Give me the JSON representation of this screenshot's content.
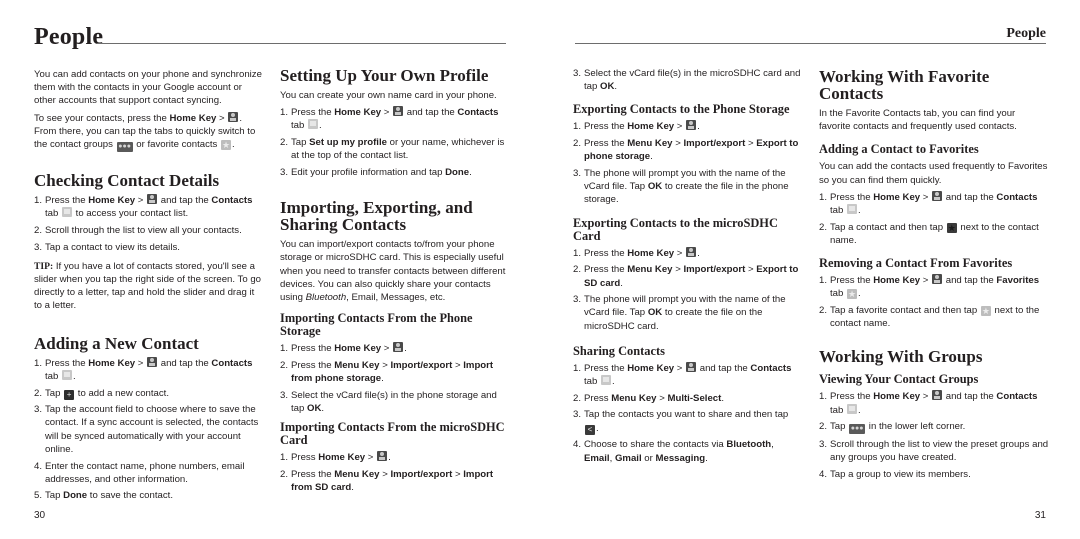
{
  "header": {
    "chapter_title": "People",
    "running_head": "People"
  },
  "page_numbers": {
    "left": "30",
    "right": "31"
  },
  "intro": {
    "p1": "You can add contacts on your phone and synchronize them with the contacts in your Google account or other accounts that support contact syncing.",
    "p2_a": "To see your contacts, press the ",
    "p2_b": "Home Key",
    "p2_c": " > ",
    "p2_d": ". From there, you can tap the tabs to quickly switch to the contact groups ",
    "p2_e": " or favorite contacts ",
    "p2_f": "."
  },
  "checking": {
    "title": "Checking Contact Details",
    "s1": {
      "n": "1.",
      "a": "Press the ",
      "b": "Home Key",
      "c": " > ",
      "d": " and tap the ",
      "e": "Contacts",
      "f": " tab ",
      "g": " to access your contact list."
    },
    "s2": {
      "n": "2.",
      "a": "Scroll through the list to view all your contacts."
    },
    "s3": {
      "n": "3.",
      "a": "Tap a contact to view its details."
    },
    "tip_label": "TIP:",
    "tip_text": " If you have a lot of contacts stored, you'll see a slider when you tap the right side of the screen. To go directly to a letter, tap and hold the slider and drag it to a letter."
  },
  "adding": {
    "title": "Adding a New Contact",
    "s1": {
      "n": "1.",
      "a": "Press the ",
      "b": "Home Key",
      "c": " > ",
      "d": " and tap the ",
      "e": "Contacts",
      "f": " tab ",
      "g": "."
    },
    "s2": {
      "n": "2.",
      "a": "Tap ",
      "b": " to add a new contact."
    },
    "s3": {
      "n": "3.",
      "a": "Tap the account field to choose where to save the contact. If a sync account is selected, the contacts will be synced automatically with your account online."
    },
    "s4": {
      "n": "4.",
      "a": "Enter the contact name, phone numbers, email addresses, and other information."
    },
    "s5": {
      "n": "5.",
      "a": "Tap ",
      "b": "Done",
      "c": " to save the contact."
    }
  },
  "profile": {
    "title": "Setting Up Your Own Profile",
    "intro": "You can create your own name card in your phone.",
    "s1": {
      "n": "1.",
      "a": "Press the ",
      "b": "Home Key",
      "c": " > ",
      "d": " and tap the ",
      "e": "Contacts",
      "f": " tab ",
      "g": "."
    },
    "s2": {
      "n": "2.",
      "a": "Tap ",
      "b": "Set up my profile",
      "c": " or your name, whichever is at the top of the contact list."
    },
    "s3": {
      "n": "3.",
      "a": "Edit your profile information and tap ",
      "b": "Done",
      "c": "."
    }
  },
  "importing": {
    "title": "Importing, Exporting, and Sharing Contacts",
    "intro_a": "You can import/export contacts to/from your phone storage or microSDHC card. This is especially useful when you need to transfer contacts between different devices. You can also quickly share your contacts using ",
    "intro_b": "Bluetooth",
    "intro_c": ", Email, Messages, etc.",
    "from_phone": {
      "title": "Importing Contacts From the Phone Storage",
      "s1": {
        "n": "1.",
        "a": "Press the ",
        "b": "Home Key",
        "c": " > ",
        "d": "."
      },
      "s2": {
        "n": "2.",
        "a": "Press the ",
        "b": "Menu Key",
        "c": " > ",
        "d": "Import/export",
        "e": " > ",
        "f": "Import from phone storage",
        "g": "."
      },
      "s3": {
        "n": "3.",
        "a": "Select the vCard file(s) in the phone storage and tap ",
        "b": "OK",
        "c": "."
      }
    },
    "from_sd": {
      "title": "Importing Contacts From the microSDHC Card",
      "s1": {
        "n": "1.",
        "a": "Press ",
        "b": "Home Key",
        "c": " > ",
        "d": "."
      },
      "s2": {
        "n": "2.",
        "a": "Press the ",
        "b": "Menu Key",
        "c": " > ",
        "d": "Import/export",
        "e": " > ",
        "f": "Import from SD card",
        "g": "."
      },
      "s3": {
        "n": "3.",
        "a": "Select the vCard file(s) in the microSDHC card and tap ",
        "b": "OK",
        "c": "."
      }
    }
  },
  "exporting": {
    "to_phone": {
      "title": "Exporting Contacts to the Phone Storage",
      "s1": {
        "n": "1.",
        "a": "Press the ",
        "b": "Home Key",
        "c": " > ",
        "d": "."
      },
      "s2": {
        "n": "2.",
        "a": "Press the ",
        "b": "Menu Key",
        "c": " > ",
        "d": "Import/export",
        "e": " > ",
        "f": "Export to phone storage",
        "g": "."
      },
      "s3": {
        "n": "3.",
        "a": "The phone will prompt you with the name of the vCard file. Tap ",
        "b": "OK",
        "c": " to create the file in the phone storage."
      }
    },
    "to_sd": {
      "title": "Exporting Contacts to the microSDHC Card",
      "s1": {
        "n": "1.",
        "a": "Press the ",
        "b": "Home Key",
        "c": " > ",
        "d": "."
      },
      "s2": {
        "n": "2.",
        "a": "Press the ",
        "b": "Menu Key",
        "c": " > ",
        "d": "Import/export",
        "e": " > ",
        "f": "Export to SD card",
        "g": "."
      },
      "s3": {
        "n": "3.",
        "a": "The phone will prompt you with the name of the vCard file. Tap ",
        "b": "OK",
        "c": " to create the file on the microSDHC card."
      }
    }
  },
  "sharing": {
    "title": "Sharing Contacts",
    "s1": {
      "n": "1.",
      "a": "Press the ",
      "b": "Home Key",
      "c": " > ",
      "d": " and tap the ",
      "e": "Contacts",
      "f": " tab ",
      "g": "."
    },
    "s2": {
      "n": "2.",
      "a": "Press ",
      "b": "Menu Key",
      "c": " > ",
      "d": "Multi-Select",
      "e": "."
    },
    "s3": {
      "n": "3.",
      "a": "Tap the contacts you want to share and then tap ",
      "b": "."
    },
    "s4": {
      "n": "4.",
      "a": "Choose to share the contacts via ",
      "b": "Bluetooth",
      "c": ", ",
      "d": "Email",
      "e": ", ",
      "f": "Gmail",
      "g": " or ",
      "h": "Messaging",
      "i": "."
    }
  },
  "favorites": {
    "title": "Working With Favorite Contacts",
    "intro": "In the Favorite Contacts tab, you can find your favorite contacts and frequently used contacts.",
    "adding": {
      "title": "Adding a Contact to Favorites",
      "intro": "You can add the contacts used frequently to Favorites so you can find them quickly.",
      "s1": {
        "n": "1.",
        "a": "Press the ",
        "b": "Home Key",
        "c": " > ",
        "d": " and tap the ",
        "e": "Contacts",
        "f": " tab ",
        "g": "."
      },
      "s2": {
        "n": "2.",
        "a": "Tap a contact and then tap ",
        "b": " next to the contact name."
      }
    },
    "removing": {
      "title": "Removing a Contact From Favorites",
      "s1": {
        "n": "1.",
        "a": "Press the ",
        "b": "Home Key",
        "c": " > ",
        "d": " and tap the ",
        "e": "Favorites",
        "f": " tab ",
        "g": "."
      },
      "s2": {
        "n": "2.",
        "a": "Tap a favorite contact and then tap ",
        "b": " next to the contact name."
      }
    }
  },
  "groups": {
    "title": "Working With Groups",
    "viewing": {
      "title": "Viewing Your Contact Groups",
      "s1": {
        "n": "1.",
        "a": "Press the ",
        "b": "Home Key",
        "c": " > ",
        "d": " and tap the ",
        "e": "Contacts",
        "f": " tab ",
        "g": "."
      },
      "s2": {
        "n": "2.",
        "a": "Tap ",
        "b": " in the lower left corner."
      },
      "s3": {
        "n": "3.",
        "a": "Scroll through the list to view the preset groups and any groups you have created."
      },
      "s4": {
        "n": "4.",
        "a": "Tap a group to view its members."
      }
    }
  },
  "icons": {
    "star": "★",
    "groups": "●●●",
    "add_contact": "+",
    "share": "<"
  }
}
